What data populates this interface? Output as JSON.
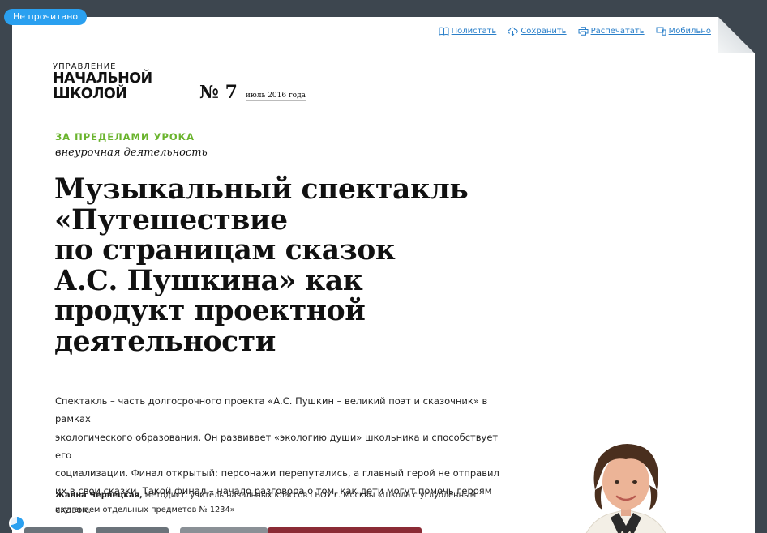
{
  "badge": {
    "unread": "Не прочитано"
  },
  "toolbar": {
    "read": "Полистать",
    "save": "Сохранить",
    "print": "Распечатать",
    "mobile": "Мобильно"
  },
  "logo": {
    "line1": "УПРАВЛЕНИЕ",
    "line2": "НАЧАЛЬНОЙ",
    "line3": "ШКОЛОЙ"
  },
  "issue": {
    "number": "№ 7",
    "date": "июль 2016 года"
  },
  "article": {
    "rubric": "ЗА ПРЕДЕЛАМИ УРОКА",
    "subrubric": "внеурочная деятельность",
    "title_lines": [
      "Музыкальный спектакль",
      "«Путешествие",
      "по страницам сказок",
      "А.С. Пушкина» как",
      "продукт проектной",
      "деятельности"
    ],
    "lead_lines": [
      "Спектакль – часть долгосрочного проекта «А.С. Пушкин – великий поэт и сказочник» в рамках",
      "экологического образования. Он развивает «экологию души» школьника и способствует его",
      "социализации. Финал открытый: персонажи перепутались, а главный герой не отправил",
      "их в свои сказки. Такой финал – начало разговора о том, как дети могут помочь героям сказок."
    ],
    "author_name": "Жанна Чернецкая,",
    "author_desc_1": " методист, учитель начальных классов ГБОУ г. Москвы «Школа с углубленным",
    "author_desc_2": "изучением отдельных предметов № 1234»"
  },
  "colors": {
    "accent": "#6ab42d",
    "link": "#2a7fc9",
    "badge": "#2aa0f0",
    "background": "#3d464f"
  }
}
